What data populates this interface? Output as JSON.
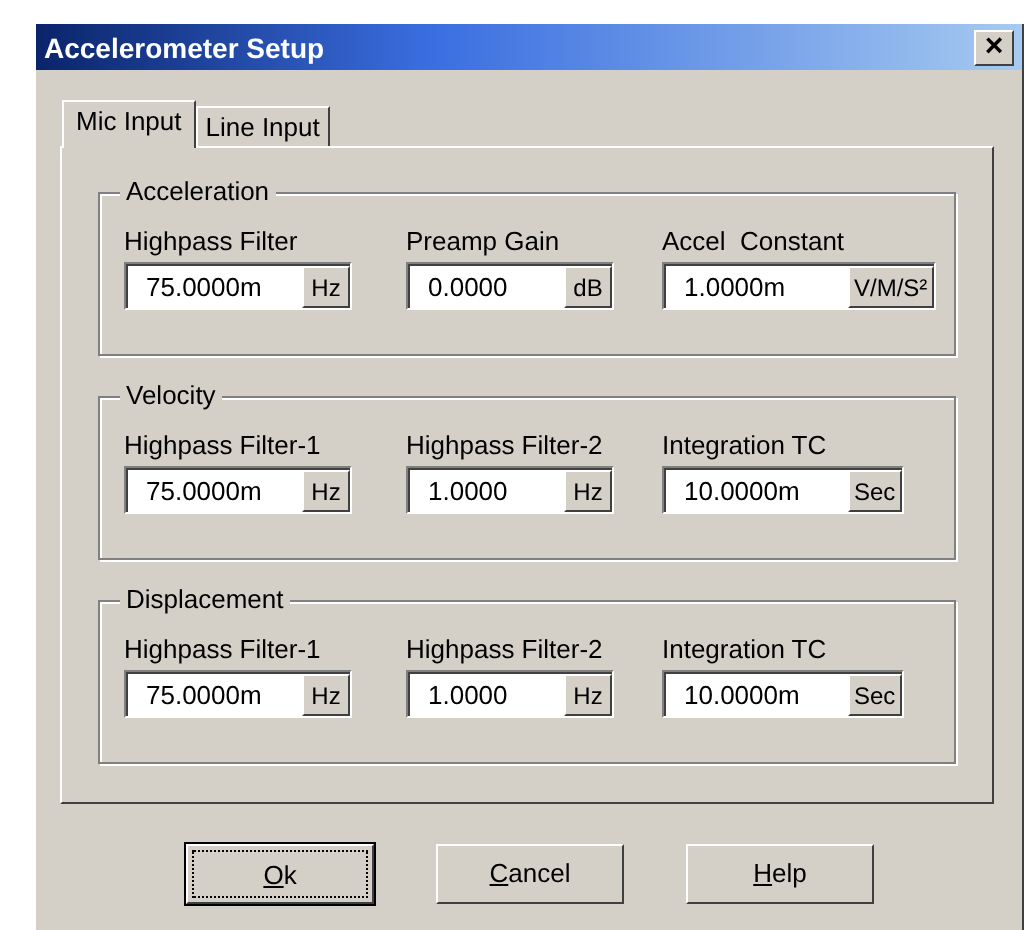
{
  "window": {
    "title": "Accelerometer Setup",
    "close": "×"
  },
  "tabs": [
    {
      "label": "Mic Input",
      "selected": true
    },
    {
      "label": "Line Input",
      "selected": false
    }
  ],
  "groups": [
    {
      "title": "Acceleration",
      "fields": [
        {
          "label": "Highpass Filter",
          "value": "75.0000m",
          "unit": "Hz"
        },
        {
          "label": "Preamp Gain",
          "value": "0.0000",
          "unit": "dB"
        },
        {
          "label": "Accel  Constant",
          "value": "1.0000m",
          "unit": "V/M/S²"
        }
      ]
    },
    {
      "title": "Velocity",
      "fields": [
        {
          "label": "Highpass Filter-1",
          "value": "75.0000m",
          "unit": "Hz"
        },
        {
          "label": "Highpass Filter-2",
          "value": "1.0000",
          "unit": "Hz"
        },
        {
          "label": "Integration TC",
          "value": "10.0000m",
          "unit": "Sec"
        }
      ]
    },
    {
      "title": "Displacement",
      "fields": [
        {
          "label": "Highpass Filter-1",
          "value": "75.0000m",
          "unit": "Hz"
        },
        {
          "label": "Highpass Filter-2",
          "value": "1.0000",
          "unit": "Hz"
        },
        {
          "label": "Integration TC",
          "value": "10.0000m",
          "unit": "Sec"
        }
      ]
    }
  ],
  "buttons": [
    {
      "label": "Ok",
      "focused": true
    },
    {
      "label": "Cancel",
      "focused": false
    },
    {
      "label": "Help",
      "focused": false
    }
  ]
}
